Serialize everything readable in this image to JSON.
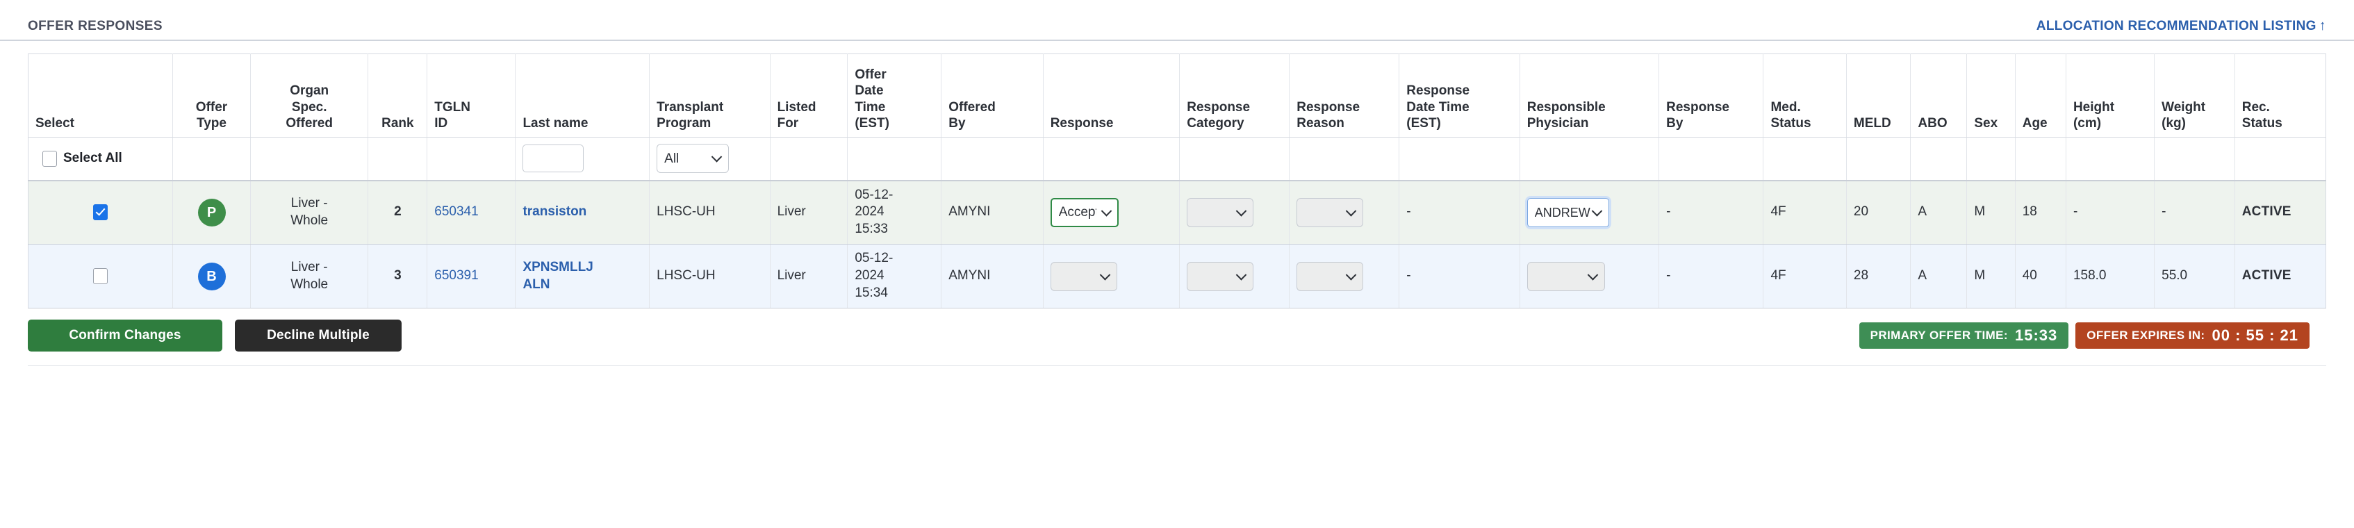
{
  "header": {
    "title": "OFFER RESPONSES",
    "allocation_link": "ALLOCATION RECOMMENDATION LISTING",
    "allocation_link_arrow": "↑"
  },
  "table": {
    "columns": [
      {
        "key": "select",
        "label": "Select"
      },
      {
        "key": "offer_type",
        "label": "Offer\nType"
      },
      {
        "key": "organ_spec",
        "label": "Organ\nSpec.\nOffered"
      },
      {
        "key": "rank",
        "label": "Rank"
      },
      {
        "key": "tgln_id",
        "label": "TGLN\nID"
      },
      {
        "key": "last_name",
        "label": "Last name"
      },
      {
        "key": "transplant_program",
        "label": "Transplant\nProgram"
      },
      {
        "key": "listed_for",
        "label": "Listed\nFor"
      },
      {
        "key": "offer_dt",
        "label": "Offer\nDate\nTime\n(EST)"
      },
      {
        "key": "offered_by",
        "label": "Offered\nBy"
      },
      {
        "key": "response",
        "label": "Response"
      },
      {
        "key": "response_category",
        "label": "Response\nCategory"
      },
      {
        "key": "response_reason",
        "label": "Response\nReason"
      },
      {
        "key": "response_dt",
        "label": "Response\nDate Time\n(EST)"
      },
      {
        "key": "responsible_physician",
        "label": "Responsible\nPhysician"
      },
      {
        "key": "response_by",
        "label": "Response\nBy"
      },
      {
        "key": "med_status",
        "label": "Med.\nStatus"
      },
      {
        "key": "meld",
        "label": "MELD"
      },
      {
        "key": "abo",
        "label": "ABO"
      },
      {
        "key": "sex",
        "label": "Sex"
      },
      {
        "key": "age",
        "label": "Age"
      },
      {
        "key": "height",
        "label": "Height\n(cm)"
      },
      {
        "key": "weight",
        "label": "Weight\n(kg)"
      },
      {
        "key": "rec_status",
        "label": "Rec.\nStatus"
      }
    ],
    "filter_row": {
      "select_all_label": "Select All",
      "select_all_checked": false,
      "last_name_value": "",
      "last_name_placeholder": "",
      "transplant_program_value": "All"
    },
    "rows": [
      {
        "row_style": "green",
        "selected": true,
        "offer_type_badge": "P",
        "offer_type_badge_color": "#3e8e49",
        "organ_spec": "Liver - Whole",
        "rank": "2",
        "tgln_id": "650341",
        "last_name": "transiston",
        "transplant_program": "LHSC-UH",
        "listed_for": "Liver",
        "offer_dt": "05-12-2024 15:33",
        "offered_by": "AMYNI",
        "response": "Accept",
        "response_category": "",
        "response_reason": "",
        "response_dt": "-",
        "responsible_physician": "ANDREW",
        "response_by": "-",
        "med_status": "4F",
        "meld": "20",
        "abo": "A",
        "sex": "M",
        "age": "18",
        "height": "-",
        "weight": "-",
        "rec_status": "ACTIVE"
      },
      {
        "row_style": "blue",
        "selected": false,
        "offer_type_badge": "B",
        "offer_type_badge_color": "#1e6fd9",
        "organ_spec": "Liver - Whole",
        "rank": "3",
        "tgln_id": "650391",
        "last_name": "XPNSMLLJ ALN",
        "transplant_program": "LHSC-UH",
        "listed_for": "Liver",
        "offer_dt": "05-12-2024 15:34",
        "offered_by": "AMYNI",
        "response": "",
        "response_category": "",
        "response_reason": "",
        "response_dt": "-",
        "responsible_physician": "",
        "response_by": "-",
        "med_status": "4F",
        "meld": "28",
        "abo": "A",
        "sex": "M",
        "age": "40",
        "height": "158.0",
        "weight": "55.0",
        "rec_status": "ACTIVE"
      }
    ]
  },
  "footer": {
    "confirm_label": "Confirm Changes",
    "decline_label": "Decline Multiple",
    "primary_offer_time_label": "PRIMARY OFFER TIME:",
    "primary_offer_time_value": "15:33",
    "offer_expires_label": "OFFER EXPIRES IN:",
    "offer_expires_value": "00 : 55 : 21"
  },
  "colors": {
    "accent_link": "#2b5fac",
    "confirm_green": "#2f7d3e",
    "decline_black": "#2b2b2b",
    "timer_green": "#3e8e55",
    "timer_red": "#b34420",
    "row_green": "#eef3ee",
    "row_blue": "#eff5fd"
  }
}
